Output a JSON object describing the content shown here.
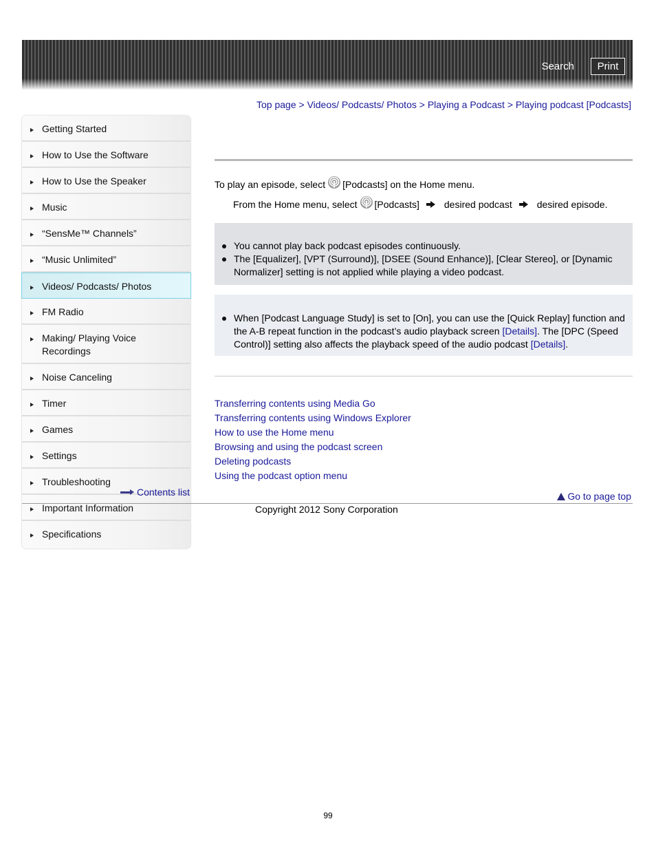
{
  "header": {
    "search_label": "Search",
    "print_label": "Print"
  },
  "breadcrumb": {
    "items": [
      "Top page",
      "Videos/ Podcasts/ Photos",
      "Playing a Podcast",
      "Playing podcast [Podcasts]"
    ],
    "separator": ">"
  },
  "sidebar": {
    "items": [
      {
        "label": "Getting Started"
      },
      {
        "label": "How to Use the Software"
      },
      {
        "label": "How to Use the Speaker"
      },
      {
        "label": "Music"
      },
      {
        "label": "“SensMe™ Channels”"
      },
      {
        "label": "“Music Unlimited”"
      },
      {
        "label": "Videos/ Podcasts/ Photos",
        "active": true
      },
      {
        "label": "FM Radio"
      },
      {
        "label": "Making/ Playing Voice Recordings"
      },
      {
        "label": "Noise Canceling"
      },
      {
        "label": "Timer"
      },
      {
        "label": "Games"
      },
      {
        "label": "Settings"
      },
      {
        "label": "Troubleshooting"
      },
      {
        "label": "Important Information"
      },
      {
        "label": "Specifications"
      }
    ],
    "contents_list_label": "Contents list"
  },
  "main": {
    "intro_before": "To play an episode, select",
    "intro_after": "[Podcasts] on the Home menu.",
    "step_before": "From the Home menu, select",
    "step_podcasts": "[Podcasts]",
    "step_2": "desired podcast",
    "step_3": "desired episode.",
    "podcast_icon": "podcast-icon",
    "notes": [
      "You cannot play back podcast episodes continuously.",
      "The [Equalizer], [VPT (Surround)], [DSEE (Sound Enhance)], [Clear Stereo], or [Dynamic Normalizer] setting is not applied while playing a video podcast."
    ],
    "hint": {
      "part1": "When [Podcast Language Study] is set to [On], you can use the [Quick Replay] function and the A-B repeat function in the podcast’s audio playback screen ",
      "link1": "[Details]",
      "part2": ". The [DPC (Speed Control)] setting also affects the playback speed of the audio podcast ",
      "link2": "[Details]",
      "part3": "."
    },
    "related_links": [
      "Transferring contents using Media Go",
      "Transferring contents using Windows Explorer",
      "How to use the Home menu",
      "Browsing and using the podcast screen",
      "Deleting podcasts",
      "Using the podcast option menu"
    ],
    "go_to_top_label": "Go to page top"
  },
  "footer": {
    "copyright": "Copyright 2012 Sony Corporation",
    "page_number": "99"
  },
  "colors": {
    "link": "#1a1a9a",
    "note_bg": "#dfe1e5",
    "hint_bg": "#ebeef2",
    "active_item_bg": "#d3eef2",
    "active_item_border": "#7ed3e6"
  }
}
